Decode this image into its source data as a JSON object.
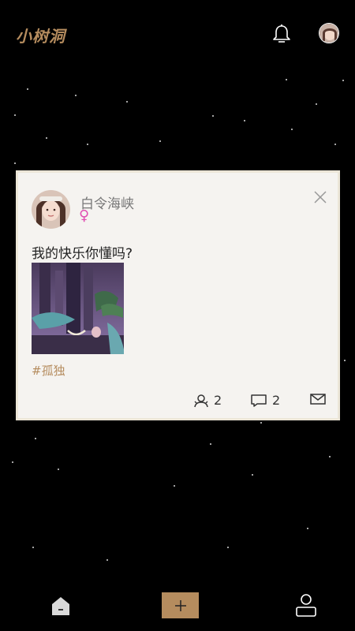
{
  "header": {
    "app_title": "小树洞",
    "notification_icon": "bell-icon"
  },
  "post": {
    "username": "白令海峡",
    "gender_symbol": "♀",
    "text": "我的快乐你懂吗?",
    "tag": "#孤独",
    "likes_count": "2",
    "comments_count": "2"
  },
  "nav": {
    "home_icon": "home-icon",
    "add_icon": "plus-icon",
    "profile_icon": "user-icon"
  },
  "colors": {
    "accent": "#b58c5e",
    "background": "#000000",
    "card": "#f5f3f0",
    "gender": "#e04fb2"
  }
}
